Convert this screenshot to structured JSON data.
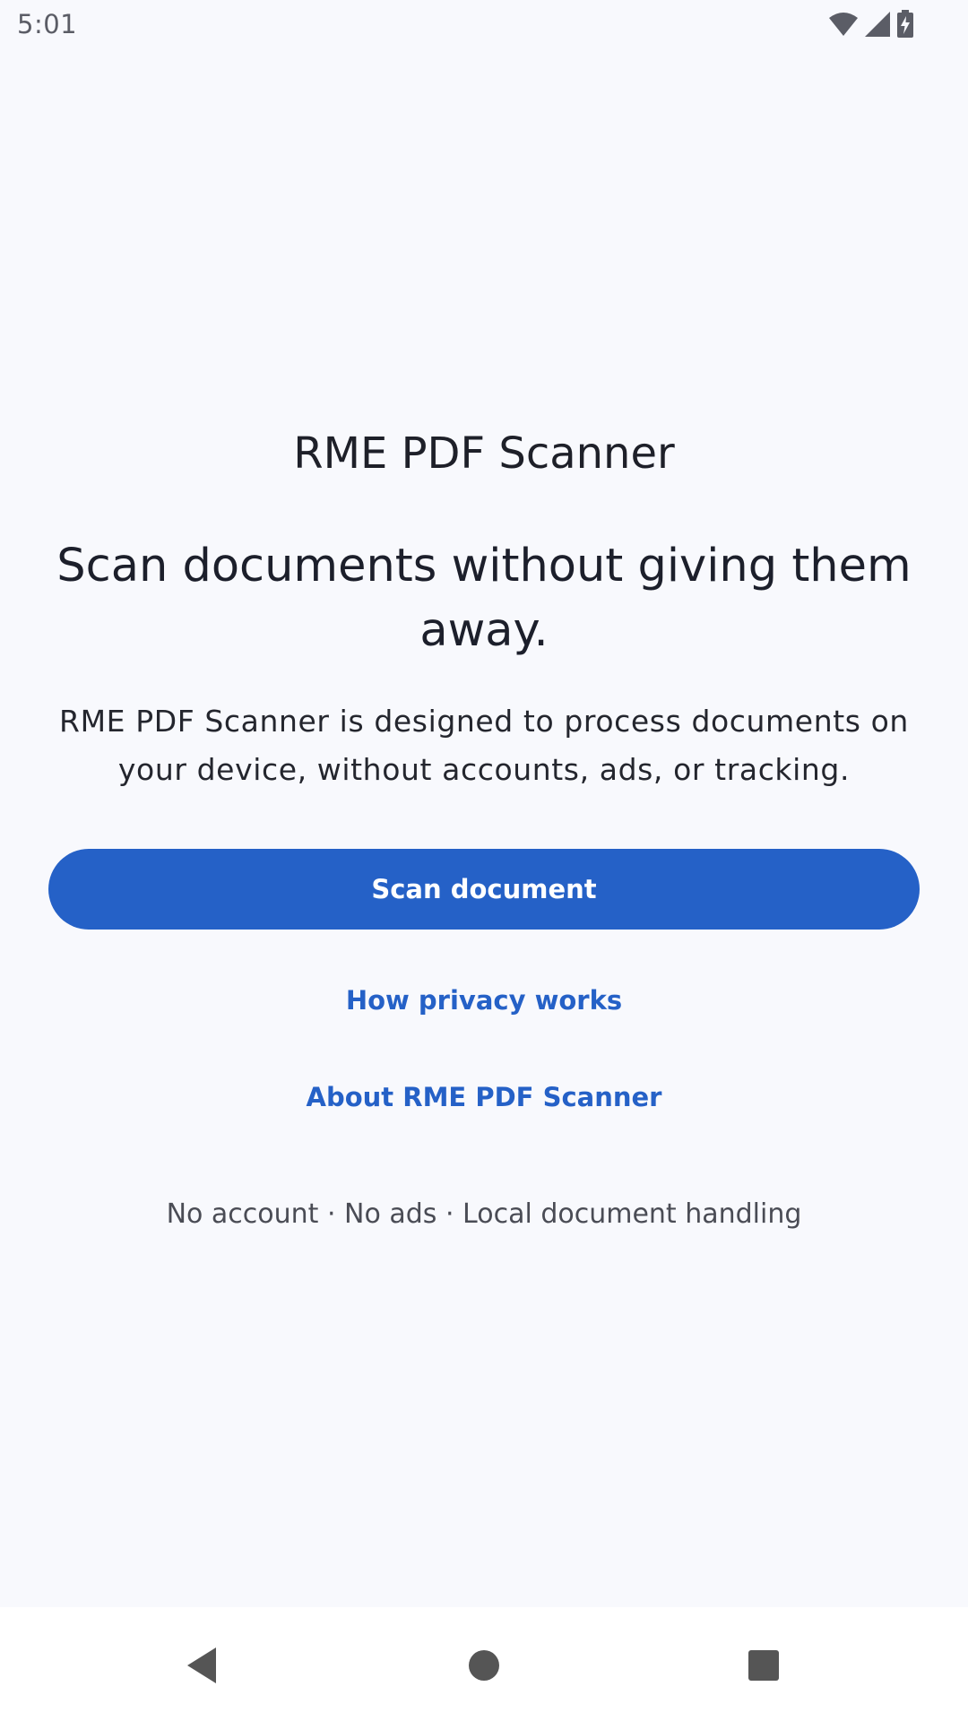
{
  "status_bar": {
    "time": "5:01",
    "icons": [
      "wifi-icon",
      "cellular-signal-icon",
      "battery-charging-icon"
    ]
  },
  "main": {
    "app_title": "RME PDF Scanner",
    "headline": "Scan documents without giving them away.",
    "description": "RME PDF Scanner is designed to process documents on your device, without accounts, ads, or tracking.",
    "scan_button_label": "Scan document",
    "privacy_link_label": "How privacy works",
    "about_link_label": "About RME PDF Scanner",
    "footer_note": "No account · No ads · Local document handling"
  },
  "nav_bar": {
    "buttons": [
      "back-icon",
      "home-icon",
      "recents-icon"
    ]
  },
  "colors": {
    "background": "#f8f9fd",
    "accent": "#2561c7",
    "text_primary": "#1c1f2b",
    "nav_background": "#ffffff"
  }
}
